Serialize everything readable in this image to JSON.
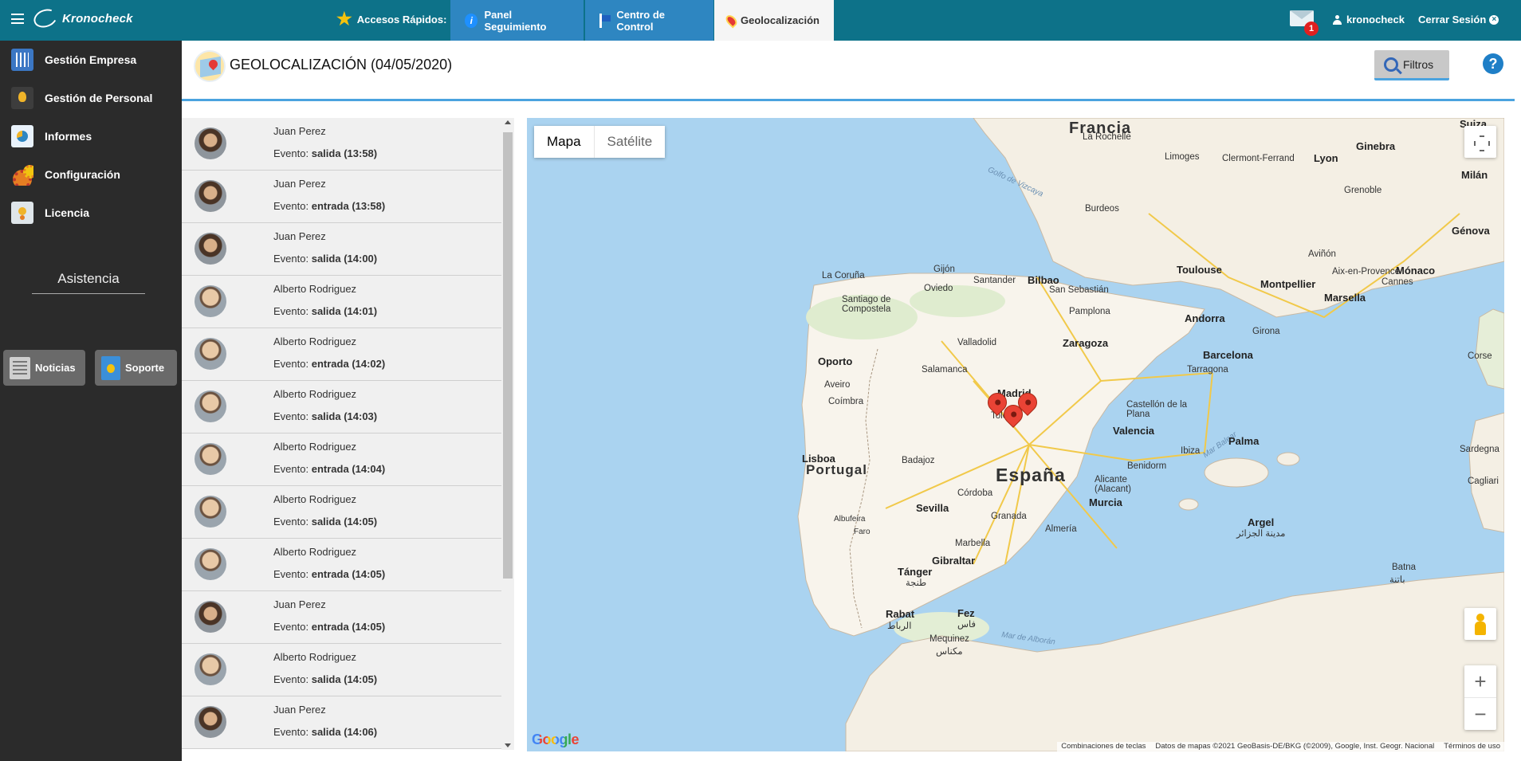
{
  "topbar": {
    "brand": "Kronocheck",
    "quick_access_label": "Accesos Rápidos:",
    "tabs": [
      {
        "label": "Panel Seguimiento",
        "icon": "info-icon"
      },
      {
        "label": "Centro de Control",
        "icon": "flag-icon"
      },
      {
        "label": "Geolocalización",
        "icon": "map-pin-icon",
        "active": true
      }
    ],
    "mail_count": "1",
    "username": "kronocheck",
    "logout_label": "Cerrar Sesión"
  },
  "sidebar": {
    "items": [
      {
        "label": "Gestión Empresa",
        "icon": "building-icon"
      },
      {
        "label": "Gestión de Personal",
        "icon": "person-bulb-icon"
      },
      {
        "label": "Informes",
        "icon": "report-chart-icon"
      },
      {
        "label": "Configuración",
        "icon": "gears-icon"
      },
      {
        "label": "Licencia",
        "icon": "certificate-icon"
      }
    ],
    "section_title": "Asistencia",
    "buttons": [
      {
        "label": "Noticias",
        "icon": "newspaper-icon"
      },
      {
        "label": "Soporte",
        "icon": "support-bulb-icon"
      }
    ]
  },
  "header": {
    "title": "GEOLOCALIZACIÓN (04/05/2020)",
    "filters_label": "Filtros",
    "help_label": "?"
  },
  "events": [
    {
      "name": "Juan Perez",
      "event_label": "Evento:",
      "type": "salida",
      "time": "(13:58)"
    },
    {
      "name": "Juan Perez",
      "event_label": "Evento:",
      "type": "entrada",
      "time": "(13:58)"
    },
    {
      "name": "Juan Perez",
      "event_label": "Evento:",
      "type": "salida",
      "time": "(14:00)"
    },
    {
      "name": "Alberto Rodriguez",
      "event_label": "Evento:",
      "type": "salida",
      "time": "(14:01)"
    },
    {
      "name": "Alberto Rodriguez",
      "event_label": "Evento:",
      "type": "entrada",
      "time": "(14:02)"
    },
    {
      "name": "Alberto Rodriguez",
      "event_label": "Evento:",
      "type": "salida",
      "time": "(14:03)"
    },
    {
      "name": "Alberto Rodriguez",
      "event_label": "Evento:",
      "type": "entrada",
      "time": "(14:04)"
    },
    {
      "name": "Alberto Rodriguez",
      "event_label": "Evento:",
      "type": "salida",
      "time": "(14:05)"
    },
    {
      "name": "Alberto Rodriguez",
      "event_label": "Evento:",
      "type": "entrada",
      "time": "(14:05)"
    },
    {
      "name": "Juan Perez",
      "event_label": "Evento:",
      "type": "entrada",
      "time": "(14:05)"
    },
    {
      "name": "Alberto Rodriguez",
      "event_label": "Evento:",
      "type": "salida",
      "time": "(14:05)"
    },
    {
      "name": "Juan Perez",
      "event_label": "Evento:",
      "type": "salida",
      "time": "(14:06)"
    }
  ],
  "map": {
    "type_map": "Mapa",
    "type_satellite": "Satélite",
    "countries": {
      "francia": "Francia",
      "espana": "España",
      "portugal": "Portugal"
    },
    "cities": {
      "la_rochelle": "La Rochelle",
      "limoges": "Limoges",
      "clermont": "Clermont-Ferrand",
      "lyon": "Lyon",
      "ginebra": "Ginebra",
      "milan": "Milán",
      "burdeos": "Burdeos",
      "grenoble": "Grenoble",
      "genova": "Génova",
      "toulouse": "Toulouse",
      "avinon": "Aviñón",
      "montpellier": "Montpellier",
      "aix": "Aix-en-Provence",
      "monaco": "Mónaco",
      "cannes": "Cannes",
      "marsella": "Marsella",
      "coruna": "La Coruña",
      "gijon": "Gijón",
      "santander": "Santander",
      "bilbao": "Bilbao",
      "oviedo": "Oviedo",
      "san_sebastian": "San Sebastián",
      "santiago": "Santiago de Compostela",
      "pamplona": "Pamplona",
      "andorra": "Andorra",
      "girona": "Girona",
      "valladolid": "Valladolid",
      "zaragoza": "Zaragoza",
      "barcelona": "Barcelona",
      "porto": "Oporto",
      "salamanca": "Salamanca",
      "tarragona": "Tarragona",
      "aveiro": "Aveiro",
      "madrid": "Madrid",
      "coimbra": "Coímbra",
      "castellon": "Castellón de la Plana",
      "toledo": "Toledo",
      "valencia": "Valencia",
      "lisboa": "Lisboa",
      "palma": "Palma",
      "badajoz": "Badajoz",
      "ibiza": "Ibiza",
      "benidorm": "Benidorm",
      "alicante": "Alicante (Alacant)",
      "cordoba": "Córdoba",
      "murcia": "Murcia",
      "sevilla": "Sevilla",
      "granada": "Granada",
      "albufeira": "Albufeira",
      "almeria": "Almería",
      "faro": "Faro",
      "marbella": "Marbella",
      "gibraltar": "Gibraltar",
      "argel": "Argel",
      "argel_ar": "مدينة الجزائر",
      "tanger": "Tánger",
      "tanger_ar": "طنجة",
      "batna": "Batna",
      "batna_ar": "باتنة",
      "rabat": "Rabat",
      "rabat_ar": "الرباط",
      "fez": "Fez",
      "fez_ar": "فاس",
      "mequinez": "Mequinez",
      "mequinez_ar": "مكناس",
      "corse": "Corse",
      "sardegna": "Sardegna",
      "cagliari": "Cagliari",
      "suiza": "Suiza"
    },
    "seas": {
      "vizcaya": "Golfo de Vizcaya",
      "balear": "Mar Balear",
      "alboran": "Mar de Alborán"
    },
    "google": "Google",
    "attribution": [
      "Combinaciones de teclas",
      "Datos de mapas ©2021 GeoBasis-DE/BKG (©2009), Google, Inst. Geogr. Nacional",
      "Términos de uso"
    ],
    "zoom_in": "+",
    "zoom_out": "−"
  }
}
